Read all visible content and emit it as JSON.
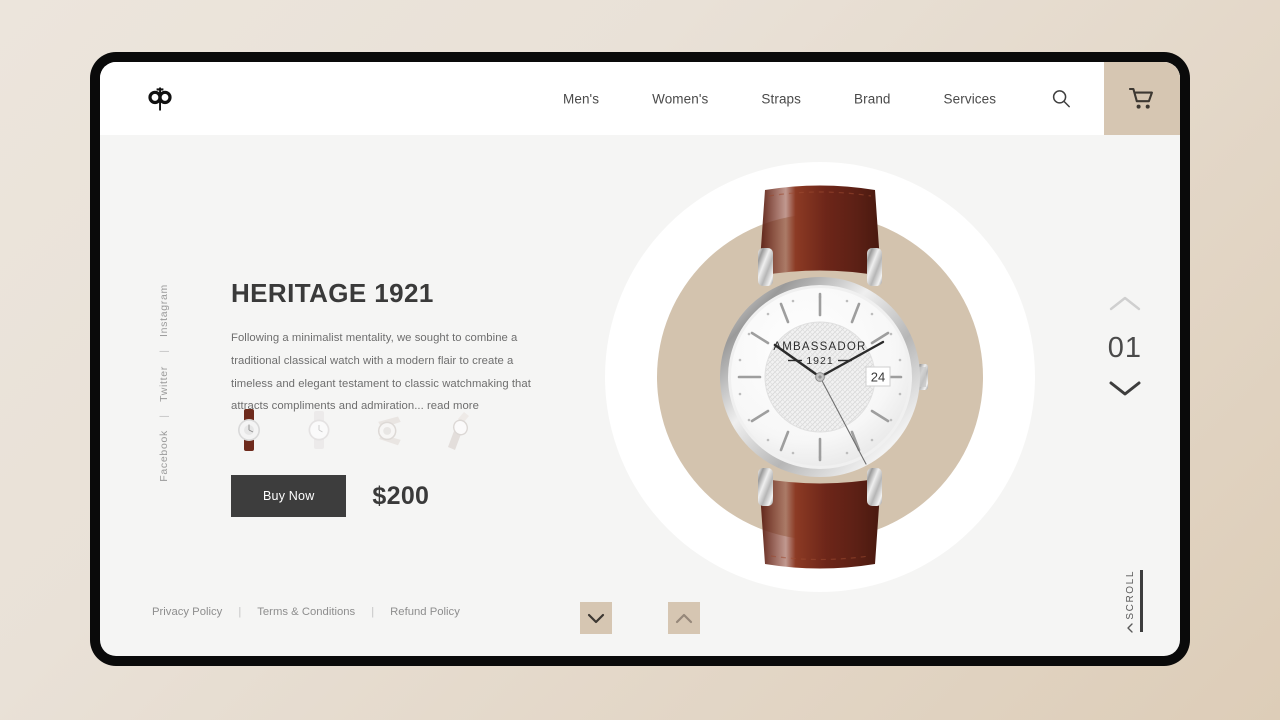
{
  "brand": {
    "logo_alt": "ambassador-monogram-logo"
  },
  "nav": {
    "items": [
      {
        "label": "Men's"
      },
      {
        "label": "Women's"
      },
      {
        "label": "Straps"
      },
      {
        "label": "Brand"
      },
      {
        "label": "Services"
      }
    ],
    "search_icon": "search-icon",
    "cart_icon": "shopping-cart-icon"
  },
  "social": {
    "items": [
      {
        "label": "Facebook"
      },
      {
        "label": "Twitter"
      },
      {
        "label": "Instagram"
      }
    ],
    "separator": "|"
  },
  "product": {
    "title": "HERITAGE 1921",
    "description": "Following a minimalist mentality, we sought to combine a traditional classical watch with a modern flair to create a timeless and elegant testament to classic watchmaking that attracts compliments and admiration...",
    "read_more_label": "read more",
    "price": "$200",
    "buy_label": "Buy Now",
    "thumbnails": [
      {
        "name": "watch-brown-leather",
        "active": true
      },
      {
        "name": "watch-white-dial",
        "active": false
      },
      {
        "name": "watch-mesh-strap",
        "active": false
      },
      {
        "name": "watch-angled-view",
        "active": false
      }
    ],
    "dial": {
      "brand_text": "AMBASSADOR",
      "year_text": "1921",
      "date_window": "24"
    }
  },
  "slider": {
    "current": "01",
    "up_icon": "chevron-up-icon",
    "down_icon": "chevron-down-icon"
  },
  "scroll": {
    "label": "SCROLL",
    "chevron_icon": "chevron-down-icon"
  },
  "carousel": {
    "next_icon": "chevron-down-icon",
    "prev_icon": "chevron-up-icon"
  },
  "footer": {
    "links": [
      {
        "label": "Privacy Policy"
      },
      {
        "label": "Terms & Conditions"
      },
      {
        "label": "Refund Policy"
      }
    ],
    "separator": "|"
  },
  "colors": {
    "page_bg_light": "#ece5dc",
    "page_bg_dark": "#ddcdb8",
    "frame": "#0a0a0a",
    "screen_bg": "#f5f5f4",
    "header_bg": "#ffffff",
    "accent_tan": "#d6c6b2",
    "hero_tan": "#d3c3ae",
    "dark_button": "#3d3d3d",
    "strap_brown": "#6e2a1c"
  }
}
